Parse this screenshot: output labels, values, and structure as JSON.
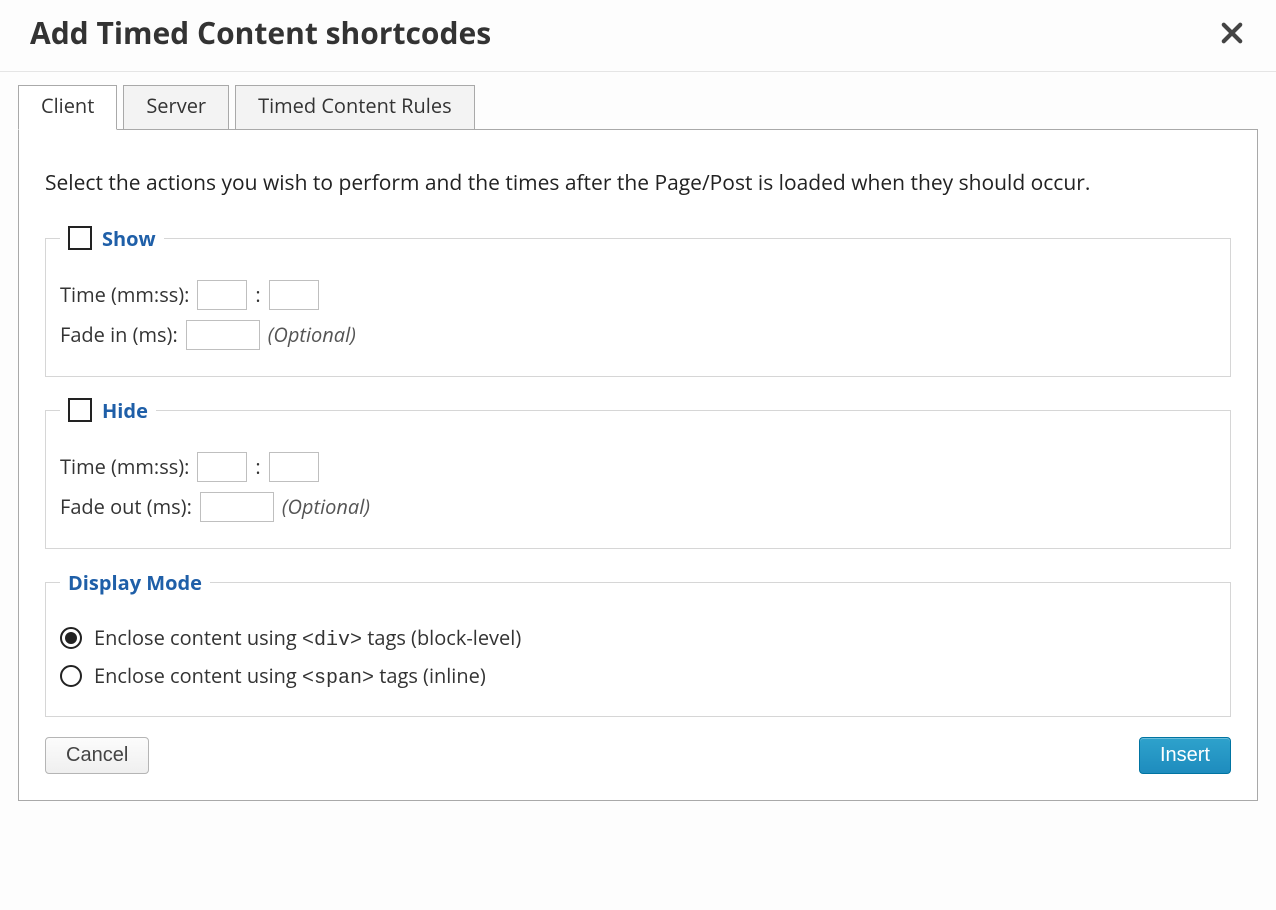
{
  "dialog": {
    "title": "Add Timed Content shortcodes"
  },
  "tabs": {
    "client": "Client",
    "server": "Server",
    "rules": "Timed Content Rules"
  },
  "intro": "Select the actions you wish to perform and the times after the Page/Post is loaded when they should occur.",
  "show": {
    "legend": "Show",
    "time_label": "Time (mm:ss):",
    "colon": ":",
    "fade_label": "Fade in (ms):",
    "optional": "(Optional)",
    "mm": "",
    "ss": "",
    "fade": ""
  },
  "hide": {
    "legend": "Hide",
    "time_label": "Time (mm:ss):",
    "colon": ":",
    "fade_label": "Fade out (ms):",
    "optional": "(Optional)",
    "mm": "",
    "ss": "",
    "fade": ""
  },
  "display_mode": {
    "legend": "Display Mode",
    "opt_div_pre": "Enclose content using ",
    "opt_div_code": "<div>",
    "opt_div_post": " tags (block-level)",
    "opt_span_pre": "Enclose content using ",
    "opt_span_code": "<span>",
    "opt_span_post": " tags (inline)"
  },
  "buttons": {
    "cancel": "Cancel",
    "insert": "Insert"
  }
}
